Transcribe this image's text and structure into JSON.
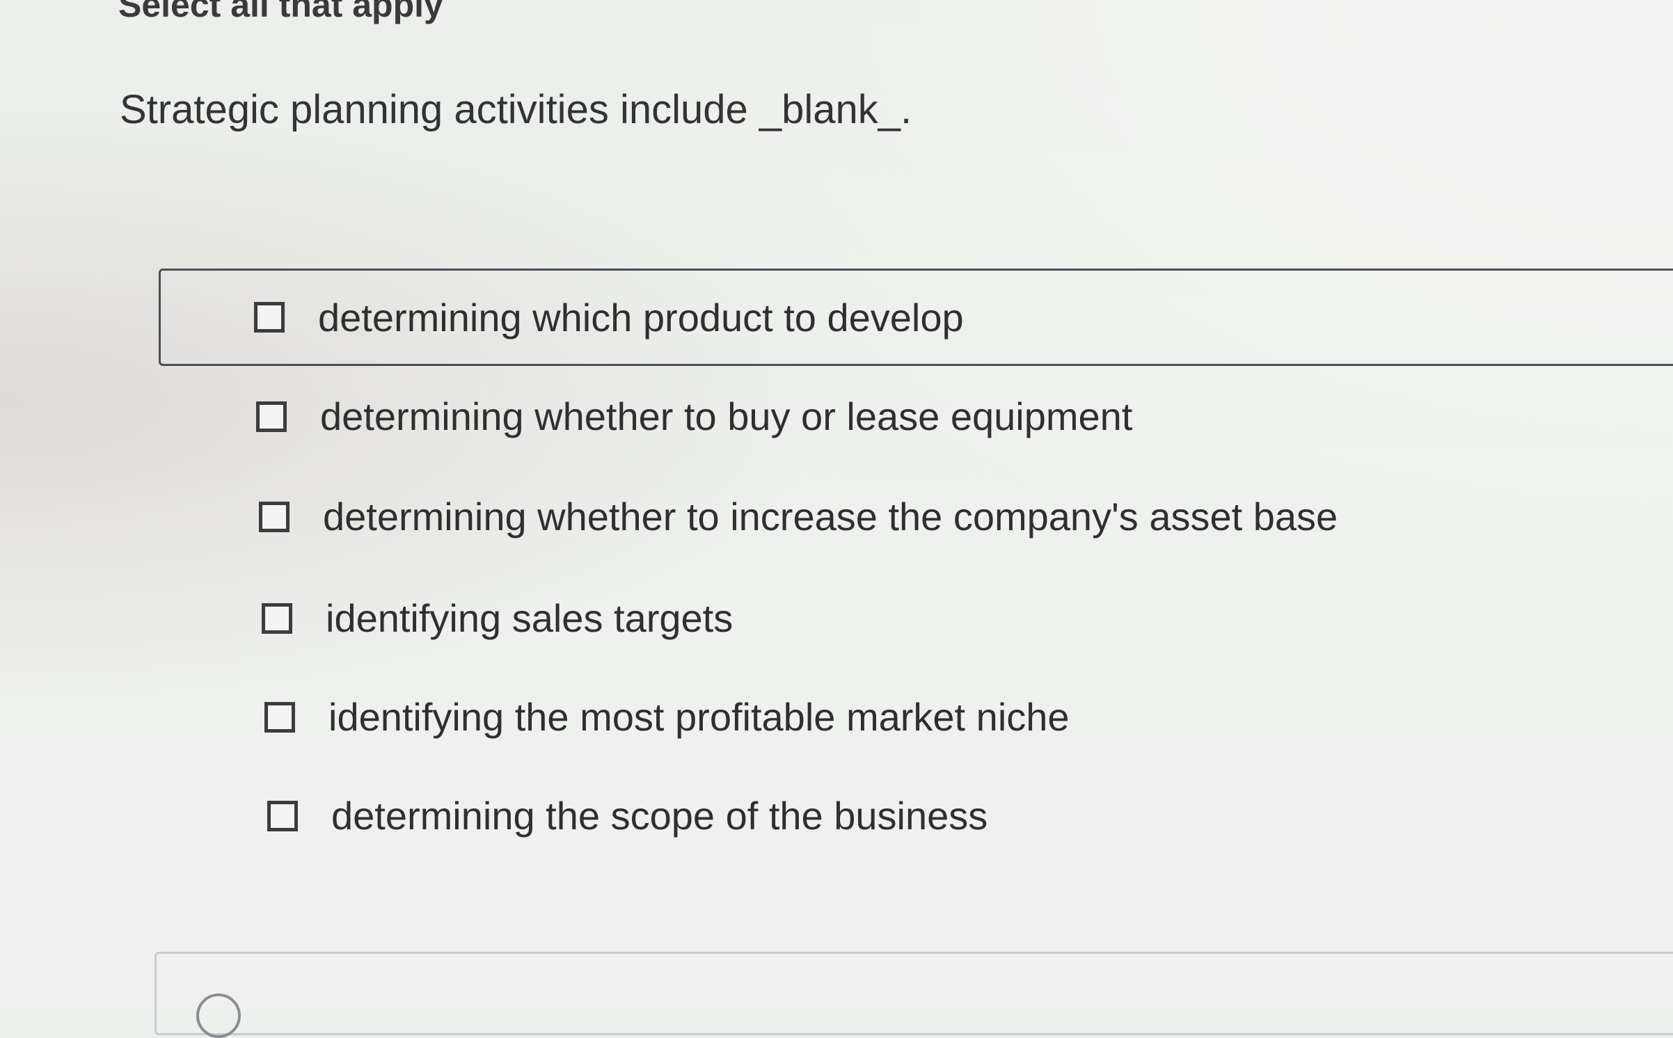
{
  "instruction": "Select all that apply",
  "question": {
    "text": "Strategic planning activities include _blank_."
  },
  "options": [
    {
      "label": "determining which product to develop",
      "checked": false,
      "focused": true
    },
    {
      "label": "determining whether to buy or lease equipment",
      "checked": false,
      "focused": false
    },
    {
      "label": "determining whether to increase the company's asset base",
      "checked": false,
      "focused": false
    },
    {
      "label": "identifying sales targets",
      "checked": false,
      "focused": false
    },
    {
      "label": "identifying the most profitable market niche",
      "checked": false,
      "focused": false
    },
    {
      "label": "determining the scope of the business",
      "checked": false,
      "focused": false
    }
  ],
  "colors": {
    "focus_border": "#4a4f55",
    "checkbox_border": "#3c3c3c",
    "text": "#2f2f2f"
  }
}
